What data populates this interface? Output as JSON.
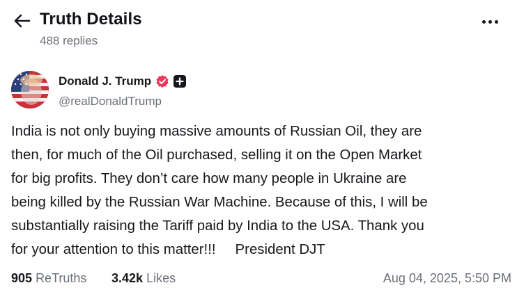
{
  "header": {
    "title": "Truth Details",
    "replies": "488 replies"
  },
  "author": {
    "name": "Donald J. Trump",
    "handle": "@realDonaldTrump"
  },
  "post": {
    "lines": [
      "India is not only buying massive amounts of Russian Oil, they are",
      "then, for much of the Oil purchased, selling it on the Open Market",
      "for big profits. They don’t care how many people in Ukraine are",
      "being killed by the Russian War Machine. Because of this, I will be",
      "substantially raising the Tariff paid by India to the USA. Thank you",
      "for your attention to this matter!!!"
    ],
    "signature": "President DJT"
  },
  "stats": {
    "retruths_count": "905",
    "retruths_label": "ReTruths",
    "likes_count": "3.42k",
    "likes_label": "Likes",
    "date": "Aug 04, 2025, 5:50 PM"
  },
  "icons": {
    "back": "arrow-left-icon",
    "more": "more-horizontal-icon",
    "verified": "verified-badge-icon",
    "plus": "plus-badge-icon"
  },
  "colors": {
    "verified": "#e8395b",
    "text": "#17181c",
    "muted": "#6b6f78"
  }
}
